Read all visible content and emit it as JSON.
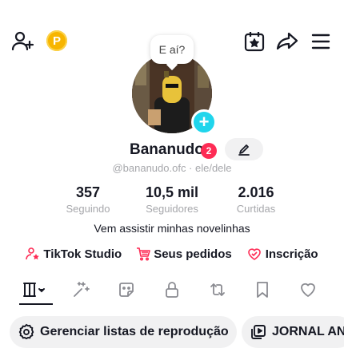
{
  "top_bar": {
    "coin_letter": "P"
  },
  "profile": {
    "bubble_text": "E aí?",
    "display_name": "Bananudo",
    "notification_count": "2",
    "handle": "@bananudo.ofc · ele/dele"
  },
  "stats": [
    {
      "value": "357",
      "label": "Seguindo"
    },
    {
      "value": "10,5 mil",
      "label": "Seguidores"
    },
    {
      "value": "2.016",
      "label": "Curtidas"
    }
  ],
  "bio": "Vem assistir minhas novelinhas",
  "links": [
    {
      "label": "TikTok Studio",
      "icon": "person-star-icon",
      "color": "#fe2c55"
    },
    {
      "label": "Seus pedidos",
      "icon": "cart-icon",
      "color": "#fe2c55"
    },
    {
      "label": "Inscrição",
      "icon": "heart-badge-icon",
      "color": "#fe2c55"
    }
  ],
  "playlists": [
    {
      "label": "Gerenciar listas de reprodução",
      "icon": "gear-icon"
    },
    {
      "label": "JORNAL AN",
      "icon": "playlist-icon"
    }
  ],
  "colors": {
    "accent": "#fe2c55",
    "coin": "#f7b500",
    "avatar_add": "#20d5ec",
    "muted_text": "#a6a7ab"
  }
}
